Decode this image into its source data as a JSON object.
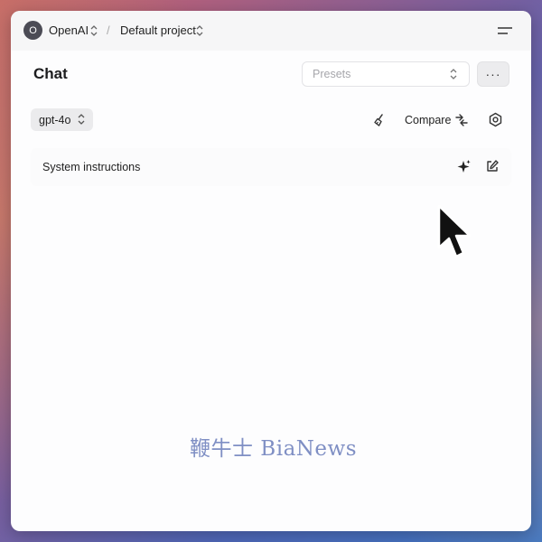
{
  "header": {
    "org_initial": "O",
    "org_name": "OpenAI",
    "separator": "/",
    "project_name": "Default project",
    "menu_icon": "hamburger-menu-icon"
  },
  "page": {
    "title": "Chat",
    "presets_placeholder": "Presets",
    "more_label": "···"
  },
  "toolbar": {
    "model": "gpt-4o",
    "clear_icon": "broom-icon",
    "compare_label": "Compare",
    "compare_icon": "compare-arrows-icon",
    "settings_icon": "settings-icon"
  },
  "system": {
    "label": "System instructions",
    "generate_icon": "sparkle-icon",
    "edit_icon": "edit-icon"
  },
  "watermark": "鞭牛士 BiaNews",
  "colors": {
    "window_bg": "#fdfdfe",
    "topbar_bg": "#f6f6f7",
    "avatar_bg": "#4b4b55",
    "watermark": "#7f8fc4"
  }
}
